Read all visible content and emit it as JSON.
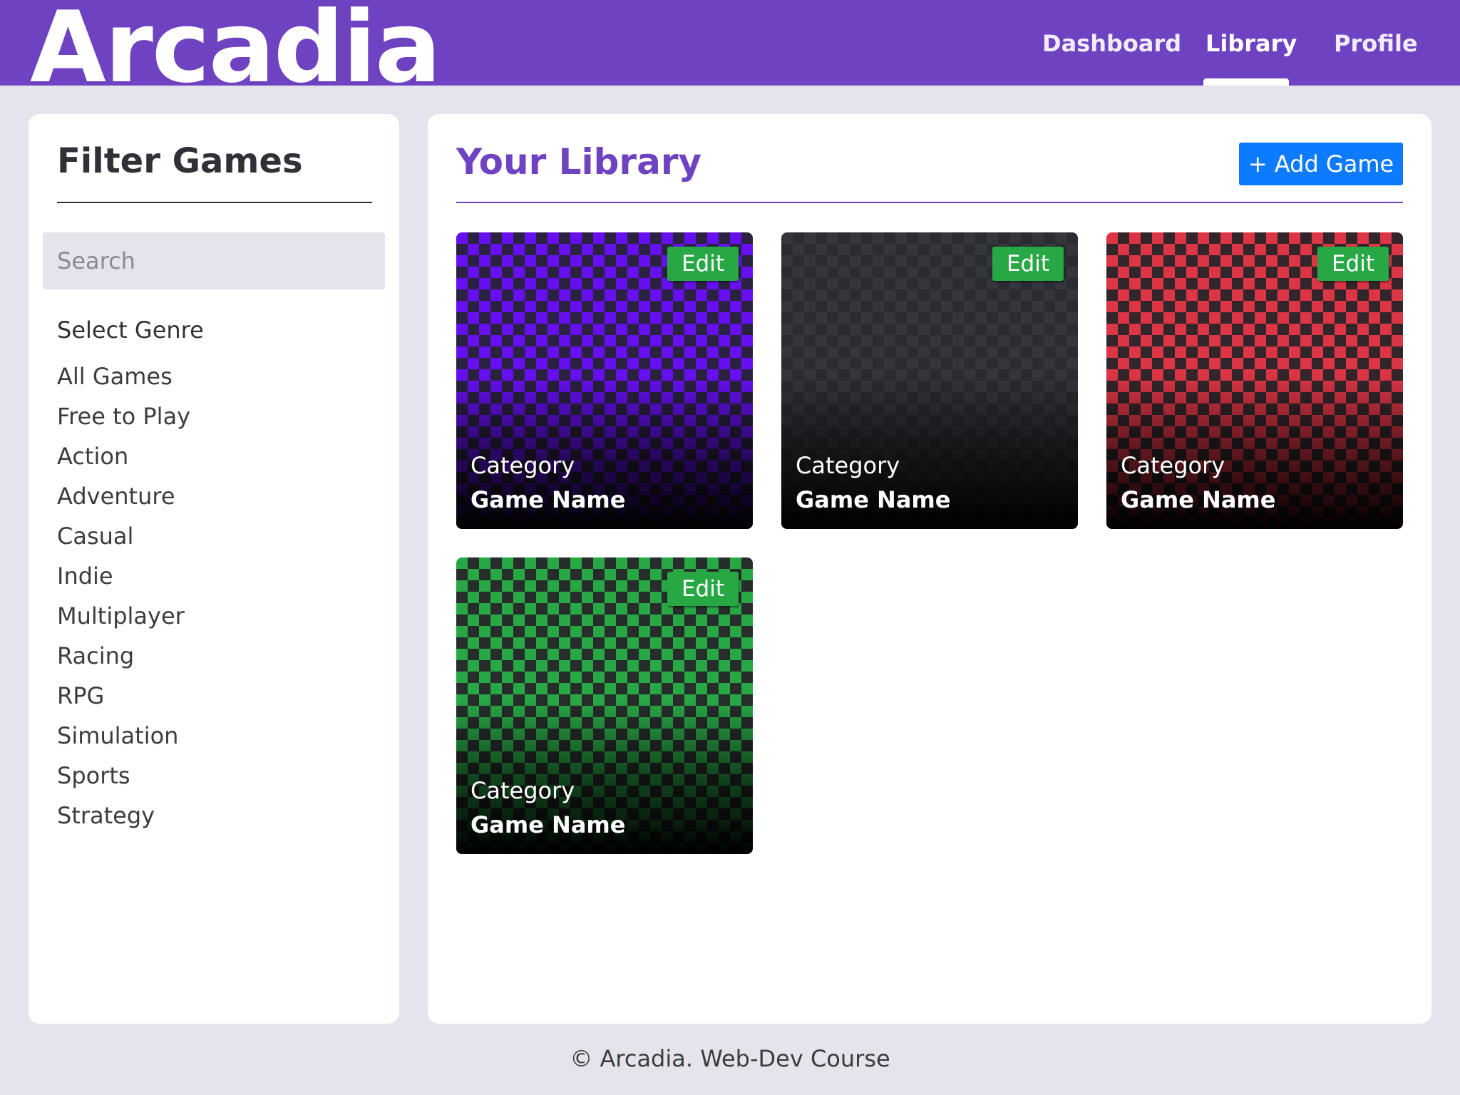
{
  "header": {
    "brand": "Arcadia",
    "nav": [
      {
        "label": "Dashboard",
        "active": false
      },
      {
        "label": "Library",
        "active": true
      },
      {
        "label": "Profile",
        "active": false
      }
    ],
    "colors": {
      "bar": "#6f42c1"
    }
  },
  "sidebar": {
    "title": "Filter Games",
    "search": {
      "placeholder": "Search",
      "value": ""
    },
    "genre_heading": "Select Genre",
    "genres": [
      "All Games",
      "Free to Play",
      "Action",
      "Adventure",
      "Casual",
      "Indie",
      "Multiplayer",
      "Racing",
      "RPG",
      "Simulation",
      "Sports",
      "Strategy"
    ]
  },
  "main": {
    "title": "Your Library",
    "add_button": "+ Add Game",
    "cards": [
      {
        "edit_label": "Edit",
        "category": "Category",
        "name": "Game Name",
        "pattern_a": "#6610f2",
        "pattern_b": "#2b2140"
      },
      {
        "edit_label": "Edit",
        "category": "Category",
        "name": "Game Name",
        "pattern_a": "#34363b",
        "pattern_b": "#2a2c31"
      },
      {
        "edit_label": "Edit",
        "category": "Category",
        "name": "Game Name",
        "pattern_a": "#dc3545",
        "pattern_b": "#33262a"
      },
      {
        "edit_label": "Edit",
        "category": "Category",
        "name": "Game Name",
        "pattern_a": "#28a745",
        "pattern_b": "#262d2b"
      }
    ],
    "colors": {
      "accent": "#6f42c1",
      "add_button": "#0d7bff",
      "edit_button": "#28a745"
    }
  },
  "footer": {
    "text": "© Arcadia. Web-Dev Course"
  }
}
